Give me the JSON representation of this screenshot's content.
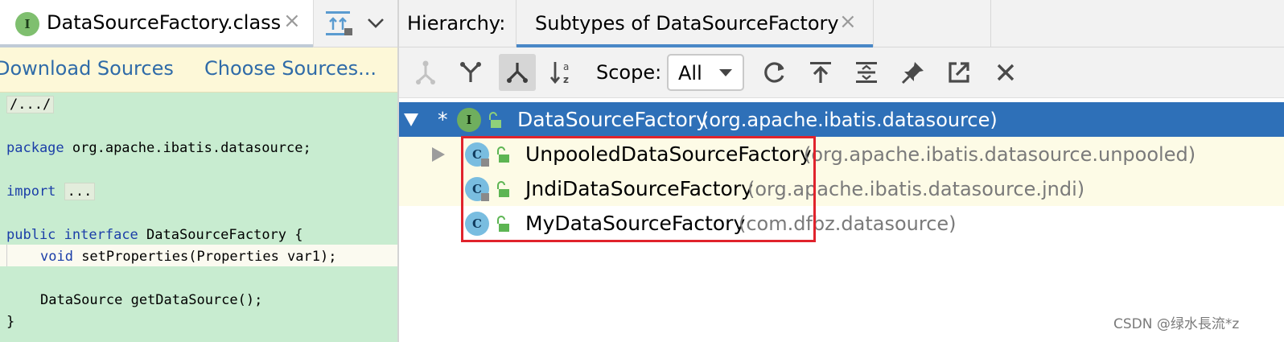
{
  "editor": {
    "tab": {
      "badge": "I",
      "label": "DataSourceFactory.class",
      "close_glyph": "×"
    },
    "banner": {
      "download_label": "Download Sources",
      "choose_label": "Choose Sources..."
    },
    "code": {
      "line_header": "/.../",
      "line_package_kw": "package",
      "line_package_rest": " org.apache.ibatis.datasource;",
      "line_import_kw": "import",
      "line_import_fold": "...",
      "line_iface_kw1": "public",
      "line_iface_kw2": "interface",
      "line_iface_rest": " DataSourceFactory {",
      "line_void_kw": "void",
      "line_void_rest": " setProperties(Properties var1);",
      "line_getds": "DataSource getDataSource();",
      "line_close": "}"
    }
  },
  "hierarchy": {
    "label": "Hierarchy:",
    "tab_label": "Subtypes of DataSourceFactory",
    "tab_close_glyph": "×",
    "toolbar": {
      "scope_label": "Scope:",
      "scope_value": "All",
      "icons": [
        "supertypes-hierarchy-icon",
        "type-hierarchy-icon",
        "subtypes-hierarchy-icon",
        "sort-alphabetically-icon",
        "refresh-icon",
        "export-icon",
        "expand-all-icon",
        "pin-icon",
        "open-in-window-icon",
        "close-icon"
      ]
    },
    "tree": {
      "root": {
        "marker": "*",
        "badge": "I",
        "name": "DataSourceFactory",
        "package": "(org.apache.ibatis.datasource)"
      },
      "children": [
        {
          "badge": "C",
          "name": "UnpooledDataSourceFactory",
          "package": "(org.apache.ibatis.datasource.unpooled)"
        },
        {
          "badge": "C",
          "name": "JndiDataSourceFactory",
          "package": "(org.apache.ibatis.datasource.jndi)"
        },
        {
          "badge": "C",
          "name": "MyDataSourceFactory",
          "package": "(com.dfbz.datasource)"
        }
      ]
    }
  },
  "colors": {
    "selected_row": "#2e70b8",
    "highlight_box": "#e0232c",
    "link": "#2f6ba8",
    "editor_bg": "#c8ecd0"
  },
  "watermark": "CSDN @绿水長流*z"
}
